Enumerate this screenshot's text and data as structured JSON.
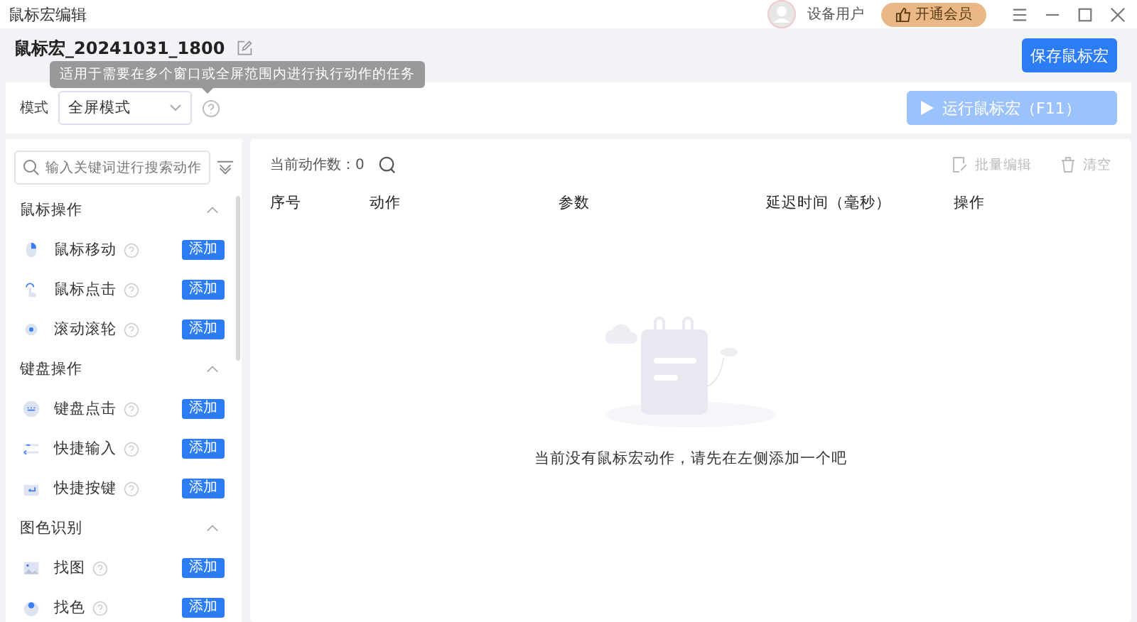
{
  "window": {
    "title": "鼠标宏编辑",
    "user": "设备用户",
    "vip_button": "开通会员"
  },
  "macro": {
    "name": "鼠标宏_20241031_1800",
    "save_button": "保存鼠标宏"
  },
  "tooltip": "适用于需要在多个窗口或全屏范围内进行执行动作的任务",
  "mode": {
    "label": "模式",
    "value": "全屏模式"
  },
  "run_button": {
    "label": "运行鼠标宏（F11）",
    "disabled": true
  },
  "sidebar": {
    "search_placeholder": "输入关键词进行搜索动作",
    "groups": [
      {
        "title": "鼠标操作",
        "expanded": true,
        "items": [
          {
            "kind": "mouse",
            "label": "鼠标移动",
            "button": "添加"
          },
          {
            "kind": "tap",
            "label": "鼠标点击",
            "button": "添加"
          },
          {
            "kind": "wheel",
            "label": "滚动滚轮",
            "button": "添加"
          }
        ]
      },
      {
        "title": "键盘操作",
        "expanded": true,
        "items": [
          {
            "kind": "keyboard",
            "label": "键盘点击",
            "button": "添加"
          },
          {
            "kind": "input",
            "label": "快捷输入",
            "button": "添加"
          },
          {
            "kind": "enter",
            "label": "快捷按键",
            "button": "添加"
          }
        ]
      },
      {
        "title": "图色识别",
        "expanded": true,
        "items": [
          {
            "kind": "image",
            "label": "找图",
            "button": "添加"
          },
          {
            "kind": "color",
            "label": "找色",
            "button": "添加"
          }
        ]
      }
    ]
  },
  "actions": {
    "count_label": "当前动作数：0",
    "batch_edit": {
      "label": "批量编辑",
      "disabled": true
    },
    "clear": {
      "label": "清空",
      "disabled": true
    },
    "columns": [
      "序号",
      "动作",
      "参数",
      "延迟时间（毫秒）",
      "操作"
    ],
    "empty_text": "当前没有鼠标宏动作，请先在左侧添加一个吧"
  }
}
